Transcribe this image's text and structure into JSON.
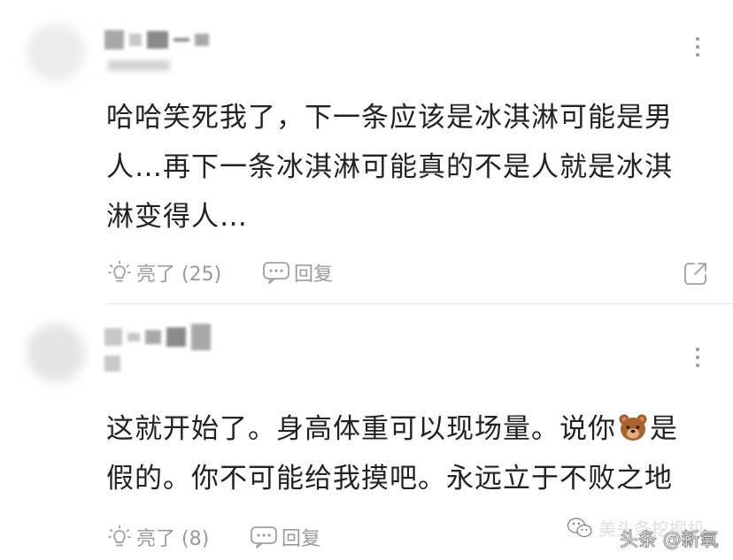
{
  "comments": [
    {
      "text": "哈哈笑死我了，下一条应该是冰淇淋可能是男人…再下一条冰淇淋可能真的不是人就是冰淇淋变得人…",
      "like_label": "亮了 (25)",
      "reply_label": "回复",
      "icons": {
        "more": "more-vertical-icon",
        "like": "lightbulb-icon",
        "reply": "comment-bubble-icon",
        "share": "share-icon"
      }
    },
    {
      "text_before": "这就开始了。身高体重可以现场量。说你",
      "emoji": "bear-emoji",
      "text_after": "是假的。你不可能给我摸吧。永远立于不败之地",
      "like_label": "亮了 (8)",
      "reply_label": "回复",
      "icons": {
        "more": "more-vertical-icon",
        "like": "lightbulb-icon",
        "reply": "comment-bubble-icon"
      }
    }
  ],
  "watermark": {
    "left_text": "美头条挖掘机",
    "right_text": "头条 @新氧",
    "icon": "wechat-icon"
  },
  "colors": {
    "text": "#222222",
    "muted": "#9a9a9a",
    "divider": "#e6e6e6",
    "background": "#ffffff"
  }
}
